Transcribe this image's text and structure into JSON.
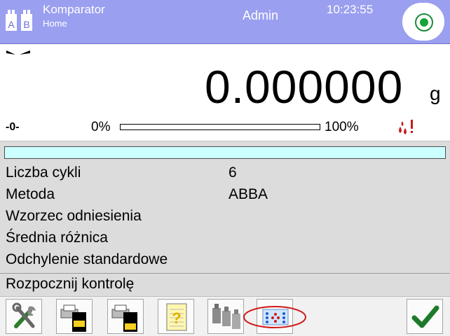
{
  "header": {
    "app_title": "Komparator",
    "app_subtitle": "Home",
    "app_icon_letters": [
      "A",
      "B"
    ],
    "user": "Admin",
    "time": "10:23:55",
    "status_icon": "status-indicator-icon",
    "colors": {
      "header_bg": "#9a9ff0",
      "status_green": "#16a53a"
    }
  },
  "display": {
    "reading": "0.000000",
    "unit": "g",
    "zero_indicator": "-0-",
    "range_min_label": "0%",
    "range_max_label": "100%",
    "load_fraction": 0,
    "icons": [
      "stability-icon",
      "drops-warning-icon"
    ]
  },
  "info": {
    "rows": [
      {
        "label": "Liczba cykli",
        "value": "6"
      },
      {
        "label": "Metoda",
        "value": "ABBA"
      },
      {
        "label": "Wzorzec odniesienia",
        "value": ""
      },
      {
        "label": "Średnia różnica",
        "value": ""
      },
      {
        "label": "Odchylenie standardowe",
        "value": ""
      }
    ],
    "start_label": "Rozpocznij kontrolę",
    "colors": {
      "info_bg": "#dcdcdc",
      "progress_bg": "#ccffff"
    }
  },
  "toolbar": {
    "buttons": [
      {
        "icon": "tools-icon"
      },
      {
        "icon": "printer-header-icon"
      },
      {
        "icon": "printer-footer-icon"
      },
      {
        "icon": "report-icon"
      },
      {
        "icon": "weights-icon"
      },
      {
        "icon": "comparator-grid-icon",
        "highlighted": true
      },
      {
        "icon": "checkmark-icon"
      }
    ],
    "colors": {
      "highlight_ring": "#d01818",
      "check_green": "#1e7a2a"
    }
  }
}
